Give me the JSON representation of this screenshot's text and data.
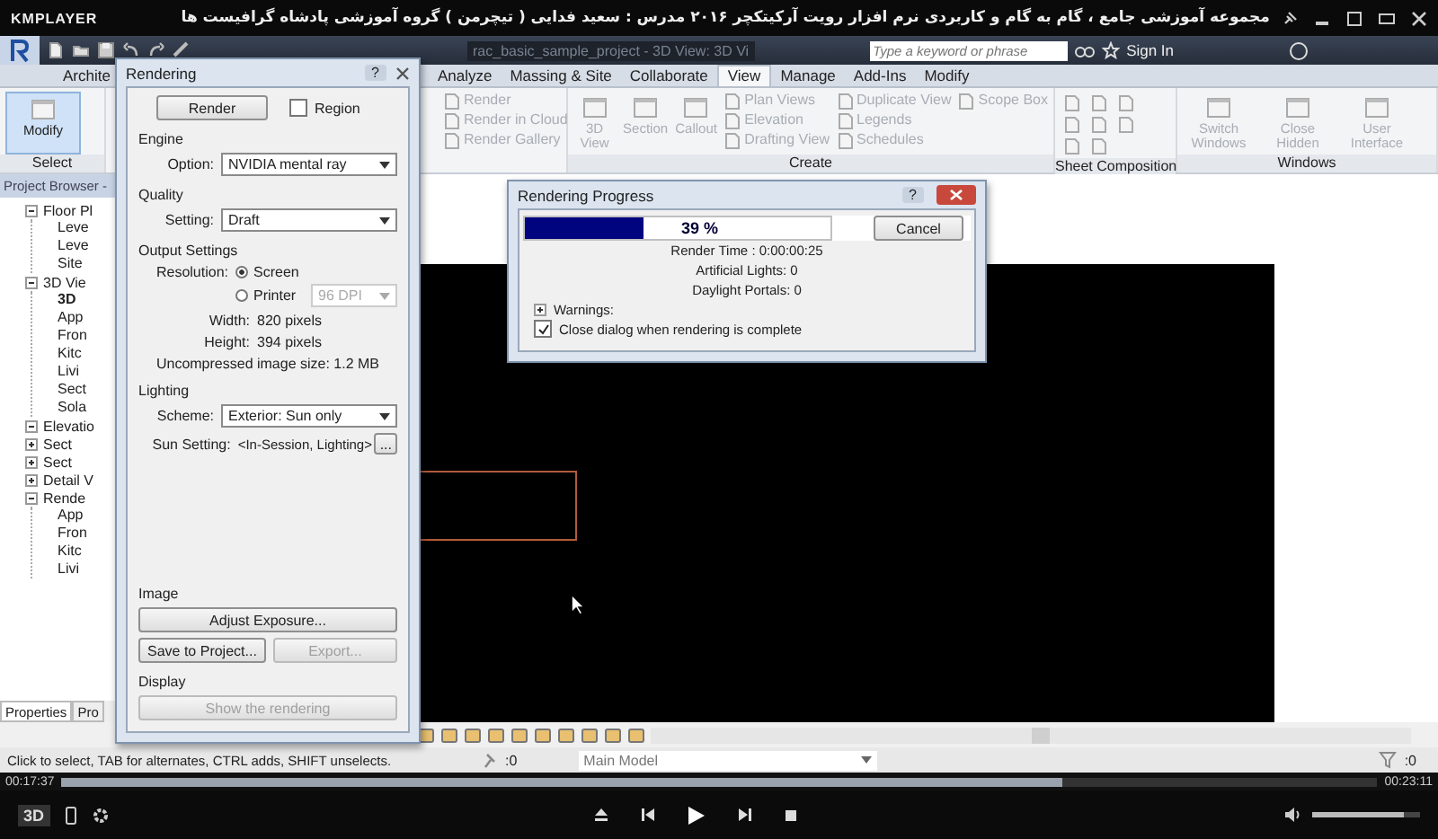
{
  "player": {
    "brand": "KMPLAYER",
    "title": "مجموعه آموزشی جامع ، گام به گام و کاربردی نرم افزار رویت آرکیتکچر ۲۰۱۶  مدرس : سعید فدایی ( تیچرمن ) گروه آموزشی پادشاه گرافیست ها",
    "elapsed": "00:17:37",
    "duration": "00:23:11",
    "seek": {
      "level": 0.76
    },
    "volume": {
      "level": 0.85
    },
    "badge": "3D"
  },
  "revit": {
    "file_title": "rac_basic_sample_project - 3D View: 3D Vi",
    "search": {
      "placeholder": "Type a keyword or phrase"
    },
    "sign_in": "Sign In",
    "tabs": [
      {
        "label": "Archite",
        "selected": false
      },
      {
        "label": "Analyze",
        "selected": false
      },
      {
        "label": "Massing & Site",
        "selected": false
      },
      {
        "label": "Collaborate",
        "selected": false
      },
      {
        "label": "View",
        "selected": true
      },
      {
        "label": "Manage",
        "selected": false
      },
      {
        "label": "Add-Ins",
        "selected": false
      },
      {
        "label": "Modify",
        "selected": false
      }
    ],
    "panels": [
      {
        "label": "Select",
        "large": [
          {
            "label": "Modify",
            "disabled": false,
            "selected": true
          }
        ]
      },
      {
        "small": [
          {
            "label": "Render",
            "disabled": true,
            "selected": false
          },
          {
            "label": "Render in Cloud",
            "disabled": true,
            "selected": false
          },
          {
            "label": "Render Gallery",
            "disabled": true,
            "selected": false
          }
        ]
      },
      {
        "label": "Create",
        "large": [
          {
            "label": "3D View",
            "disabled": true,
            "selected": false
          },
          {
            "label": "Section",
            "disabled": true,
            "selected": false
          },
          {
            "label": "Callout",
            "disabled": true,
            "selected": false
          }
        ],
        "small": [
          {
            "label": "Plan Views",
            "disabled": true,
            "selected": false
          },
          {
            "label": "Elevation",
            "disabled": true,
            "selected": false
          },
          {
            "label": "Drafting View",
            "disabled": true,
            "selected": false
          },
          {
            "label": "Duplicate View",
            "disabled": true,
            "selected": false
          },
          {
            "label": "Legends",
            "disabled": true,
            "selected": false
          },
          {
            "label": "Schedules",
            "disabled": true,
            "selected": false
          },
          {
            "label": "Scope Box",
            "disabled": true,
            "selected": false
          }
        ]
      },
      {
        "label": "Sheet Composition"
      },
      {
        "label": "Windows",
        "large": [
          {
            "label": "Switch Windows",
            "disabled": true,
            "selected": false
          },
          {
            "label": "Close Hidden",
            "disabled": true,
            "selected": false
          },
          {
            "label": "User Interface",
            "disabled": true,
            "selected": false
          }
        ]
      }
    ],
    "browser": {
      "title": "Project Browser -",
      "tree": [
        {
          "label": "Floor Pl",
          "expanded": true,
          "children": [
            {
              "label": "Leve",
              "selected": false
            },
            {
              "label": "Leve",
              "selected": false
            },
            {
              "label": "Site",
              "selected": false
            }
          ]
        },
        {
          "label": "3D Vie",
          "expanded": true,
          "children": [
            {
              "label": "3D",
              "selected": true
            },
            {
              "label": "App",
              "selected": false
            },
            {
              "label": "Fron",
              "selected": false
            },
            {
              "label": "Kitc",
              "selected": false
            },
            {
              "label": "Livi",
              "selected": false
            },
            {
              "label": "Sect",
              "selected": false
            },
            {
              "label": "Sola",
              "selected": false
            }
          ]
        },
        {
          "label": "Elevatio",
          "expanded": true
        },
        {
          "label": "Sect",
          "expanded": false
        },
        {
          "label": "Sect",
          "expanded": false
        },
        {
          "label": "Detail V",
          "expanded": false
        },
        {
          "label": "Rende",
          "expanded": true,
          "children": [
            {
              "label": "App",
              "selected": false
            },
            {
              "label": "Fron",
              "selected": false
            },
            {
              "label": "Kitc",
              "selected": false
            },
            {
              "label": "Livi",
              "selected": false
            }
          ]
        }
      ],
      "tabs": [
        {
          "label": "Properties",
          "selected": true
        },
        {
          "label": "Pro",
          "selected": false
        }
      ]
    },
    "status": {
      "message": "Click to select, TAB for alternates, CTRL adds, SHIFT unselects.",
      "count": ":0",
      "model": "Main Model",
      "filter_count": ":0"
    }
  },
  "rendering": {
    "title": "Rendering",
    "help": "?",
    "render_button": "Render",
    "region": {
      "label": "Region",
      "checked": false
    },
    "engine": {
      "heading": "Engine",
      "label": "Option:",
      "value": "NVIDIA mental ray"
    },
    "quality": {
      "heading": "Quality",
      "label": "Setting:",
      "value": "Draft"
    },
    "output": {
      "heading": "Output Settings",
      "resolution_label": "Resolution:",
      "options": [
        {
          "label": "Screen",
          "selected": true
        },
        {
          "label": "Printer",
          "selected": false
        }
      ],
      "dpi": "96 DPI",
      "rows": [
        {
          "label": "Width:",
          "value": "820 pixels"
        },
        {
          "label": "Height:",
          "value": "394 pixels"
        }
      ],
      "size": "Uncompressed image size:  1.2 MB"
    },
    "lighting": {
      "heading": "Lighting",
      "scheme_label": "Scheme:",
      "scheme": "Exterior: Sun only",
      "sun_label": "Sun Setting:",
      "sun": "<In-Session, Lighting>",
      "more": "..."
    },
    "image": {
      "heading": "Image",
      "adjust": "Adjust Exposure...",
      "save": "Save to Project...",
      "export": "Export..."
    },
    "display": {
      "heading": "Display",
      "show": "Show the rendering"
    }
  },
  "progress": {
    "title": "Rendering Progress",
    "help": "?",
    "level": 0.39,
    "percent": "39 %",
    "cancel": "Cancel",
    "lines": [
      "Render Time : 0:00:00:25",
      "Artificial Lights: 0",
      "Daylight Portals: 0"
    ],
    "warnings": {
      "label": "Warnings:",
      "expanded": false
    },
    "close_option": {
      "label": "Close dialog when rendering is complete",
      "checked": true
    }
  }
}
